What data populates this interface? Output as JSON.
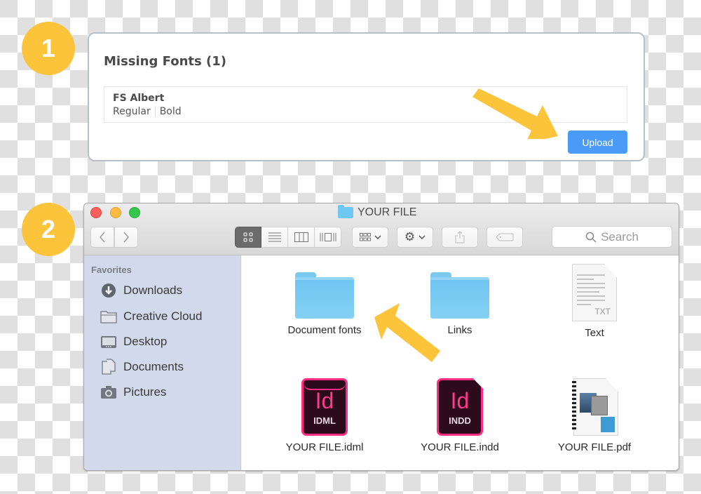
{
  "steps": {
    "step1": "1",
    "step2": "2"
  },
  "missing_fonts_panel": {
    "title": "Missing Fonts (1)",
    "font": {
      "name": "FS Albert",
      "styles": [
        "Regular",
        "Bold"
      ]
    },
    "upload_button": "Upload",
    "accent_color": "#4a9bf5"
  },
  "finder": {
    "window_title": "YOUR FILE",
    "toolbar": {
      "back_icon": "chevron-left-icon",
      "forward_icon": "chevron-right-icon",
      "view_modes": [
        "icon-view",
        "list-view",
        "column-view",
        "cover-flow-view"
      ],
      "active_view": "icon-view",
      "search_placeholder": "Search"
    },
    "sidebar": {
      "heading": "Favorites",
      "items": [
        {
          "label": "Downloads",
          "icon": "download-icon"
        },
        {
          "label": "Creative Cloud",
          "icon": "folder-icon"
        },
        {
          "label": "Desktop",
          "icon": "desktop-icon"
        },
        {
          "label": "Documents",
          "icon": "documents-icon"
        },
        {
          "label": "Pictures",
          "icon": "camera-icon"
        }
      ]
    },
    "files": [
      {
        "name": "Document fonts",
        "type": "folder"
      },
      {
        "name": "Links",
        "type": "folder"
      },
      {
        "name": "Text",
        "type": "txt",
        "badge": "TXT"
      },
      {
        "name": "YOUR FILE.idml",
        "type": "idml",
        "glyph": "Id",
        "badge": "IDML"
      },
      {
        "name": "YOUR FILE.indd",
        "type": "indd",
        "glyph": "Id",
        "badge": "INDD"
      },
      {
        "name": "YOUR FILE.pdf",
        "type": "pdf"
      }
    ]
  },
  "colors": {
    "badge": "#fbc43a",
    "arrow": "#fbc43a",
    "indesign_pink": "#ff2d82",
    "sidebar_bg": "#d1d9ea"
  }
}
